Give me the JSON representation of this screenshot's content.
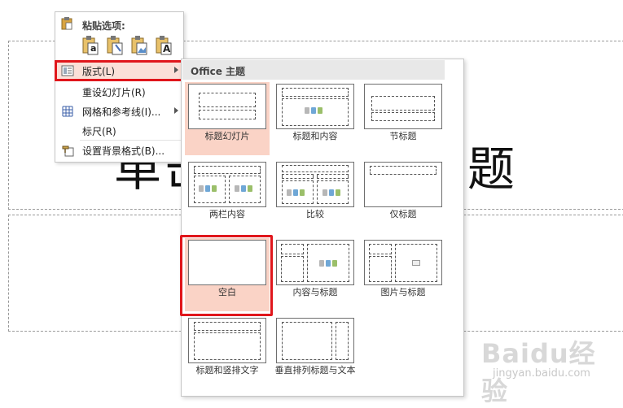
{
  "slide": {
    "title_text": "单击此处添加标题"
  },
  "context_menu": {
    "paste_header": "粘贴选项:",
    "paste_icon_letters": [
      "a",
      "",
      "",
      "A"
    ],
    "items": [
      {
        "label": "版式(L)",
        "has_submenu": true,
        "highlighted": true,
        "icon": "layout-icon"
      },
      {
        "label": "重设幻灯片(R)",
        "has_submenu": false,
        "icon": ""
      },
      {
        "label": "网格和参考线(I)...",
        "has_submenu": true,
        "icon": "grid-icon"
      },
      {
        "label": "标尺(R)",
        "has_submenu": false,
        "icon": ""
      },
      {
        "label": "设置背景格式(B)...",
        "has_submenu": false,
        "icon": "background-format-icon"
      }
    ]
  },
  "layout_gallery": {
    "header": "Office 主题",
    "layouts": [
      {
        "label": "标题幻灯片",
        "selected": true
      },
      {
        "label": "标题和内容",
        "selected": false
      },
      {
        "label": "节标题",
        "selected": false
      },
      {
        "label": "两栏内容",
        "selected": false
      },
      {
        "label": "比较",
        "selected": false
      },
      {
        "label": "仅标题",
        "selected": false
      },
      {
        "label": "空白",
        "selected": true
      },
      {
        "label": "内容与标题",
        "selected": false
      },
      {
        "label": "图片与标题",
        "selected": false
      },
      {
        "label": "标题和竖排文字",
        "selected": false
      },
      {
        "label": "垂直排列标题与文本",
        "selected": false
      }
    ]
  },
  "watermark": {
    "brand": "Baidu经验",
    "url": "jingyan.baidu.com"
  },
  "colors": {
    "highlight_red": "#e0161b",
    "selected_tile": "#fad3c6"
  }
}
